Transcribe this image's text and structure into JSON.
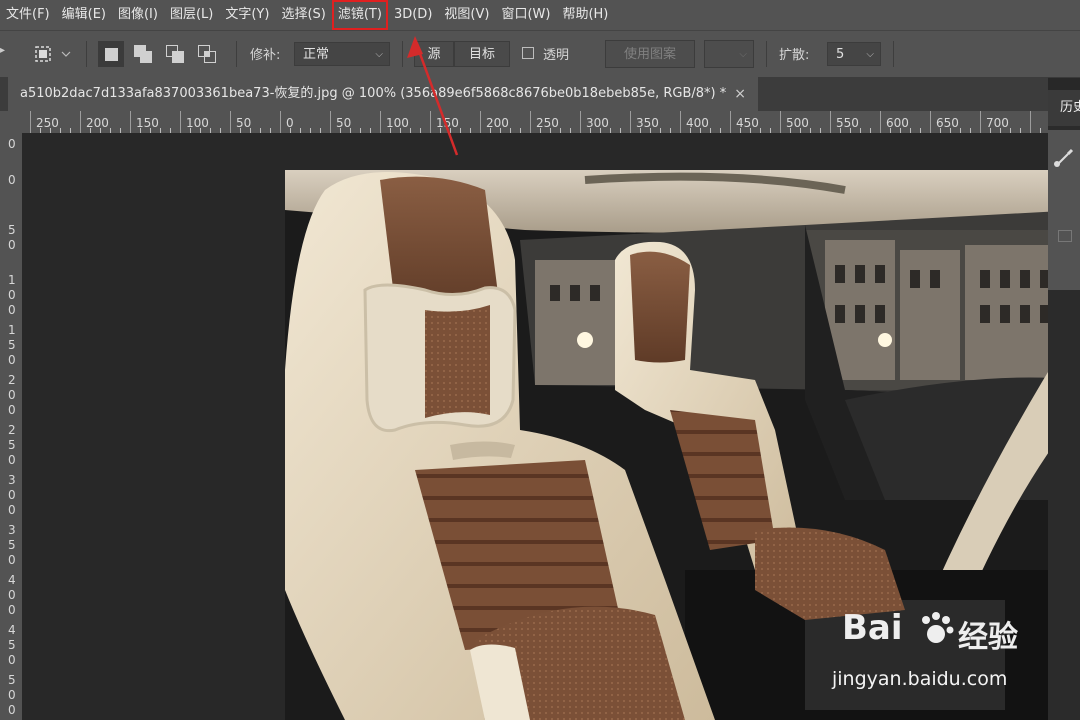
{
  "menubar": {
    "items": [
      "文件(F)",
      "编辑(E)",
      "图像(I)",
      "图层(L)",
      "文字(Y)",
      "选择(S)",
      "滤镜(T)",
      "3D(D)",
      "视图(V)",
      "窗口(W)",
      "帮助(H)"
    ],
    "highlighted": "滤镜(T)"
  },
  "options": {
    "patch_label": "修补:",
    "patch_value": "正常",
    "source_label": "源",
    "target_label": "目标",
    "transparent_label": "透明",
    "use_pattern_label": "使用图案",
    "diffuse_label": "扩散:",
    "diffuse_value": "5"
  },
  "document": {
    "tab_title": "a510b2dac7d133afa837003361bea73-恢复的.jpg @ 100% (356a89e6f5868c8676be0b18ebeb85e, RGB/8*) *",
    "close_glyph": "×"
  },
  "rulers": {
    "horizontal": [
      "250",
      "200",
      "150",
      "100",
      "50",
      "0",
      "50",
      "100",
      "150",
      "200",
      "250",
      "300",
      "350",
      "400",
      "450",
      "500",
      "550",
      "600",
      "650",
      "700"
    ],
    "vertical": [
      "0",
      "0",
      "5",
      "0",
      "1",
      "0",
      "0",
      "1",
      "5",
      "0",
      "2",
      "0",
      "0",
      "2",
      "5",
      "0",
      "3",
      "0",
      "0",
      "3",
      "5",
      "0",
      "4",
      "0",
      "0",
      "4",
      "5",
      "0",
      "5",
      "0",
      "0"
    ]
  },
  "panel": {
    "title": "历史"
  },
  "watermark": {
    "brand": "Bai",
    "brand_cn": "经验",
    "url": "jingyan.baidu.com"
  },
  "colors": {
    "highlight": "#e02020",
    "arrow": "#d42b2b",
    "ui_bg": "#535353",
    "canvas_bg": "#282828"
  }
}
